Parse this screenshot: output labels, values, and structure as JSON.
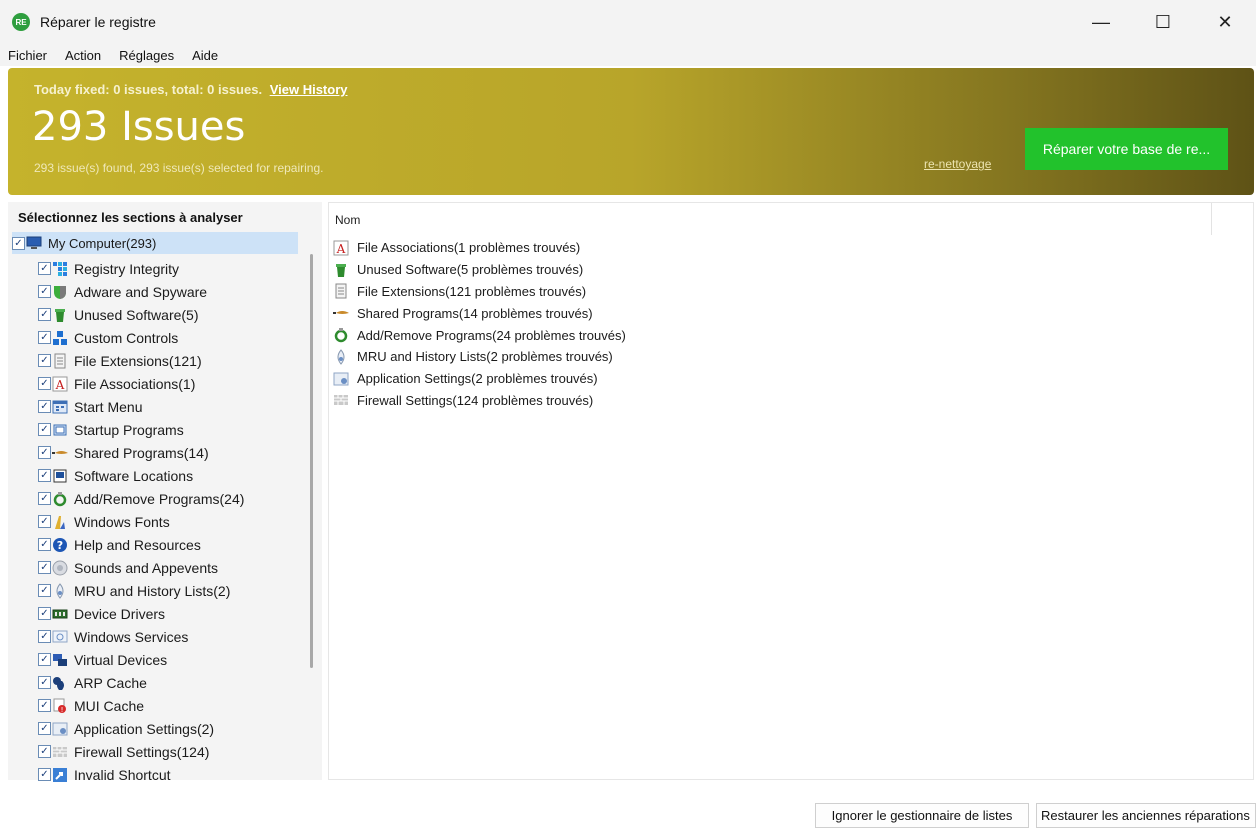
{
  "window": {
    "title": "Réparer le registre",
    "app_icon": "app-logo-icon",
    "controls": {
      "minimize": "—",
      "maximize": "☐",
      "close": "✕"
    }
  },
  "menu": [
    "Fichier",
    "Action",
    "Réglages",
    "Aide"
  ],
  "banner": {
    "today_text": "Today fixed: 0 issues, total: 0 issues.",
    "history_link": "View History",
    "issues_title": "293 Issues",
    "issues_sub": "293 issue(s) found, 293 issue(s) selected for repairing.",
    "reclean_link": "re-nettoyage",
    "repair_button": "Réparer votre base de re...",
    "colors": {
      "banner_start": "#c5b32c",
      "banner_end": "#5e5216",
      "repair_button": "#22c22c"
    }
  },
  "left_panel": {
    "header": "Sélectionnez les sections à analyser",
    "root": {
      "label": "My Computer(293)",
      "icon": "computer-icon",
      "checked": true
    },
    "items": [
      {
        "label": "Registry Integrity",
        "icon": "registry-integrity-icon",
        "checked": true
      },
      {
        "label": "Adware and Spyware",
        "icon": "adware-shield-icon",
        "checked": true
      },
      {
        "label": "Unused Software(5)",
        "icon": "trash-bin-icon",
        "checked": true
      },
      {
        "label": "Custom Controls",
        "icon": "custom-controls-icon",
        "checked": true
      },
      {
        "label": "File Extensions(121)",
        "icon": "file-extension-icon",
        "checked": true
      },
      {
        "label": "File Associations(1)",
        "icon": "file-association-icon",
        "checked": true
      },
      {
        "label": "Start Menu",
        "icon": "start-menu-icon",
        "checked": true
      },
      {
        "label": "Startup Programs",
        "icon": "startup-programs-icon",
        "checked": true
      },
      {
        "label": "Shared Programs(14)",
        "icon": "shared-programs-icon",
        "checked": true
      },
      {
        "label": "Software Locations",
        "icon": "software-locations-icon",
        "checked": true
      },
      {
        "label": "Add/Remove Programs(24)",
        "icon": "recycle-icon",
        "checked": true
      },
      {
        "label": "Windows Fonts",
        "icon": "fonts-icon",
        "checked": true
      },
      {
        "label": "Help and Resources",
        "icon": "help-icon",
        "checked": true
      },
      {
        "label": "Sounds and Appevents",
        "icon": "sound-icon",
        "checked": true
      },
      {
        "label": "MRU and History Lists(2)",
        "icon": "history-icon",
        "checked": true
      },
      {
        "label": "Device Drivers",
        "icon": "device-driver-icon",
        "checked": true
      },
      {
        "label": "Windows Services",
        "icon": "windows-services-icon",
        "checked": true
      },
      {
        "label": "Virtual Devices",
        "icon": "virtual-devices-icon",
        "checked": true
      },
      {
        "label": "ARP Cache",
        "icon": "arp-cache-icon",
        "checked": true
      },
      {
        "label": "MUI Cache",
        "icon": "mui-cache-icon",
        "checked": true
      },
      {
        "label": "Application Settings(2)",
        "icon": "app-settings-icon",
        "checked": true
      },
      {
        "label": "Firewall Settings(124)",
        "icon": "firewall-icon",
        "checked": true
      },
      {
        "label": "Invalid Shortcut",
        "icon": "shortcut-icon",
        "checked": true
      }
    ]
  },
  "right_panel": {
    "column_header": "Nom",
    "results": [
      {
        "label": "File Associations(1 problèmes trouvés)",
        "icon": "file-association-icon"
      },
      {
        "label": "Unused Software(5 problèmes trouvés)",
        "icon": "trash-bin-icon"
      },
      {
        "label": "File Extensions(121 problèmes trouvés)",
        "icon": "file-extension-icon"
      },
      {
        "label": "Shared Programs(14 problèmes trouvés)",
        "icon": "shared-programs-icon"
      },
      {
        "label": "Add/Remove Programs(24 problèmes trouvés)",
        "icon": "recycle-icon"
      },
      {
        "label": "MRU and History Lists(2 problèmes trouvés)",
        "icon": "history-icon"
      },
      {
        "label": "Application Settings(2 problèmes trouvés)",
        "icon": "app-settings-icon"
      },
      {
        "label": "Firewall Settings(124 problèmes trouvés)",
        "icon": "firewall-icon"
      }
    ]
  },
  "footer": {
    "ignore_button": "Ignorer le gestionnaire de listes",
    "restore_button": "Restaurer les anciennes réparations"
  }
}
